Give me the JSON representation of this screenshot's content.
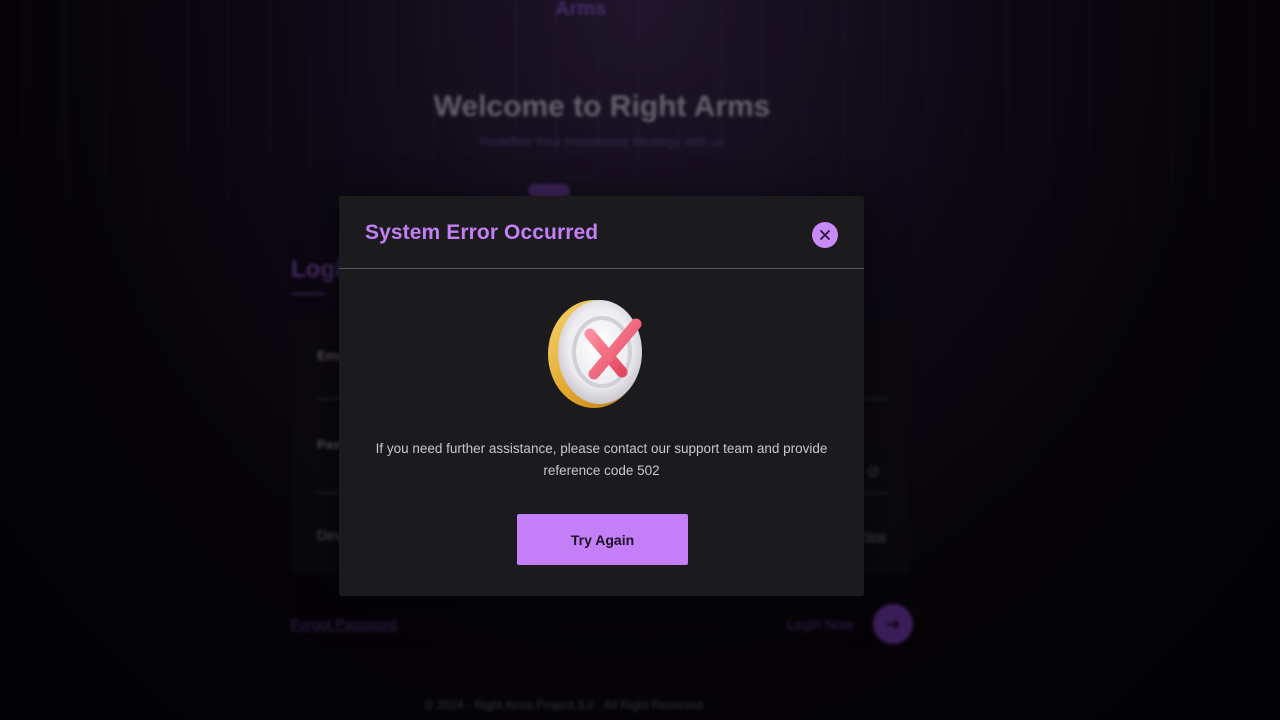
{
  "background": {
    "logo_text": "Arms",
    "welcome_title": "Welcome to Right Arms",
    "welcome_subtitle": "Redefine Your Investment Strategy with us",
    "login_title": "Login",
    "email_label": "Email",
    "password_label": "Password",
    "remember_label": "Device",
    "new_link": "New",
    "forgot_password": "Forgot Password",
    "login_now": "Login Now",
    "footer": "© 2024 · Right Arms Project 3.0 · All Right Reserved"
  },
  "modal": {
    "title": "System Error Occurred",
    "close_icon": "close-icon",
    "illustration_icon": "error-x-icon",
    "message": "If you need further assistance, please contact our support team and provide reference code 502",
    "button_label": "Try Again"
  },
  "colors": {
    "accent": "#c47ef7",
    "modal_bg": "#1b1b1d",
    "error_red": "#f06b7d",
    "gold": "#e6b23a"
  }
}
